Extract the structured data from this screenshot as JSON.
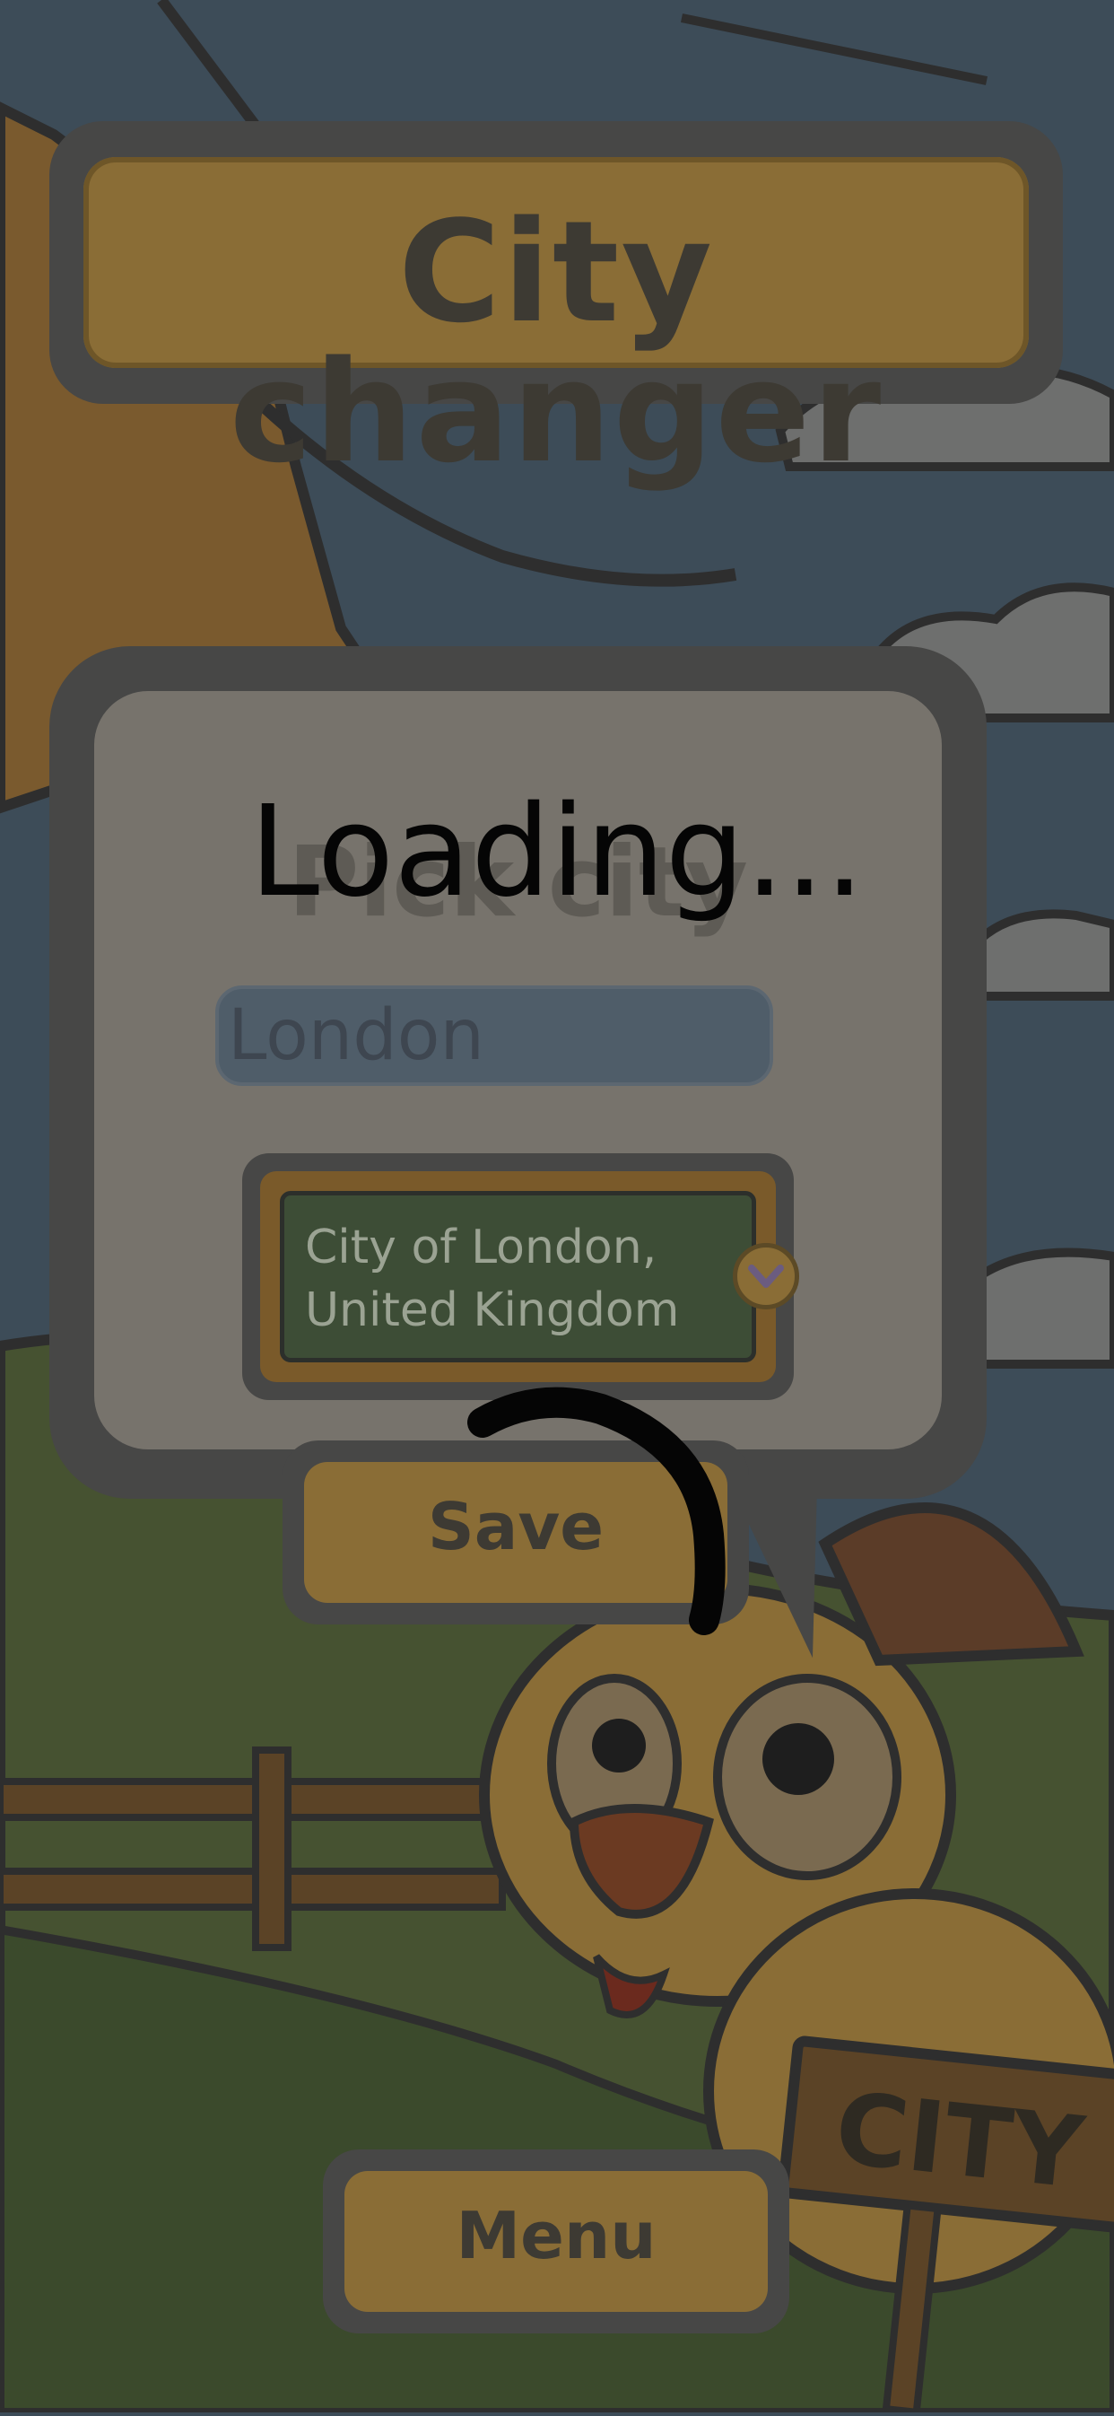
{
  "title": "City changer",
  "panel": {
    "heading": "Pick city",
    "city_input": {
      "value": "London",
      "placeholder": ""
    },
    "selected_city": {
      "line1": "City of London,",
      "line2": "United Kingdom"
    },
    "save_label": "Save"
  },
  "menu_label": "Menu",
  "overlay": {
    "loading_text": "Loading..."
  },
  "sign_text": "CITY",
  "icons": [
    "chevron-down-icon",
    "loading-spinner-icon"
  ],
  "colors": {
    "background_sky": "#3d4c58",
    "frame": "#474746",
    "button_fill": "#8a6d36",
    "input_fill": "#4f5d69",
    "select_fill": "#3d4d36"
  }
}
